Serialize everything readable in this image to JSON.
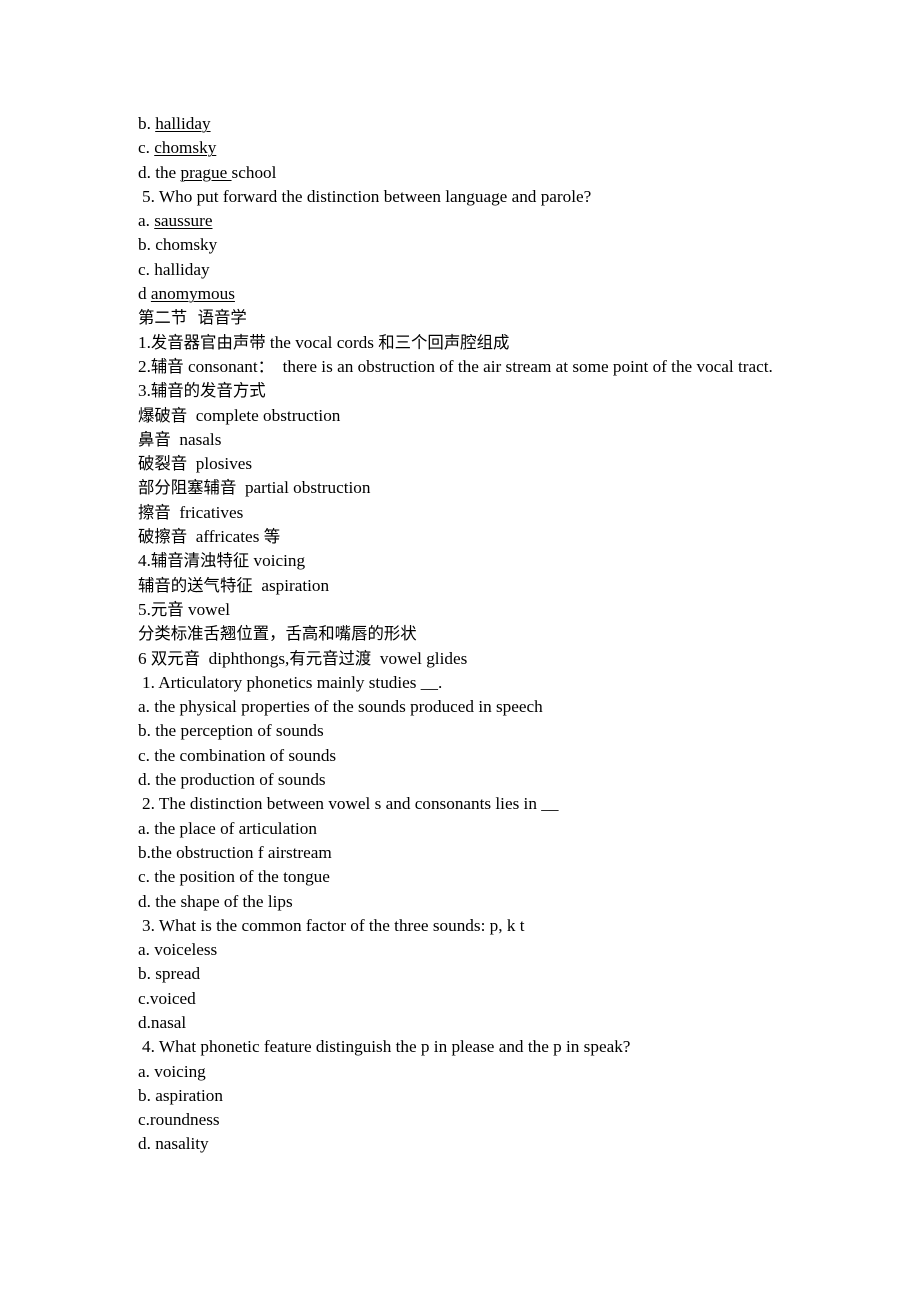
{
  "document": {
    "lines": [
      {
        "id": "opt-b-halliday",
        "indent": "option",
        "segments": [
          {
            "text": "b. ",
            "underline": false
          },
          {
            "text": "halliday",
            "underline": true
          }
        ]
      },
      {
        "id": "opt-c-chomsky",
        "indent": "option",
        "segments": [
          {
            "text": "c. ",
            "underline": false
          },
          {
            "text": "chomsky",
            "underline": true
          }
        ]
      },
      {
        "id": "opt-d-prague-school",
        "indent": "option",
        "segments": [
          {
            "text": "d. the ",
            "underline": false
          },
          {
            "text": "prague ",
            "underline": true
          },
          {
            "text": "school",
            "underline": false
          }
        ]
      },
      {
        "id": "question-5",
        "indent": "question",
        "segments": [
          {
            "text": "5. Who put forward the distinction between language and parole?",
            "underline": false
          }
        ]
      },
      {
        "id": "opt-a-saussure",
        "indent": "option",
        "segments": [
          {
            "text": "a. ",
            "underline": false
          },
          {
            "text": "saussure",
            "underline": true
          }
        ]
      },
      {
        "id": "opt-b-chomsky",
        "indent": "option",
        "segments": [
          {
            "text": "b. chomsky",
            "underline": false
          }
        ]
      },
      {
        "id": "opt-c-halliday",
        "indent": "option",
        "segments": [
          {
            "text": "c. halliday",
            "underline": false
          }
        ]
      },
      {
        "id": "opt-d-anomymous",
        "indent": "option",
        "segments": [
          {
            "text": "d ",
            "underline": false
          },
          {
            "text": "anomymous",
            "underline": true
          }
        ]
      },
      {
        "id": "section-heading",
        "indent": "option",
        "segments": [
          {
            "text": "第二节  语音学",
            "underline": false,
            "cjk": true
          }
        ]
      },
      {
        "id": "note-1-vocal-organs",
        "indent": "option",
        "segments": [
          {
            "text": "1.",
            "underline": false
          },
          {
            "text": "发音器官由声带",
            "underline": false,
            "cjk": true
          },
          {
            "text": " the vocal cords ",
            "underline": false
          },
          {
            "text": "和三个回声腔组成",
            "underline": false,
            "cjk": true
          }
        ]
      },
      {
        "id": "note-2-consonant",
        "indent": "option",
        "segments": [
          {
            "text": "2.",
            "underline": false
          },
          {
            "text": "辅音",
            "underline": false,
            "cjk": true
          },
          {
            "text": " consonant",
            "underline": false
          },
          {
            "text": "：",
            "underline": false,
            "cjk": true
          },
          {
            "text": "  there is an obstruction of the air stream at some point of the vocal tract.",
            "underline": false
          }
        ]
      },
      {
        "id": "note-3-manner",
        "indent": "option",
        "segments": [
          {
            "text": "3.",
            "underline": false
          },
          {
            "text": "辅音的发音方式",
            "underline": false,
            "cjk": true
          }
        ]
      },
      {
        "id": "term-complete-obstruction",
        "indent": "option",
        "segments": [
          {
            "text": "爆破音",
            "underline": false,
            "cjk": true
          },
          {
            "text": "  complete obstruction",
            "underline": false
          }
        ]
      },
      {
        "id": "term-nasals",
        "indent": "option",
        "segments": [
          {
            "text": "鼻音",
            "underline": false,
            "cjk": true
          },
          {
            "text": "  nasals",
            "underline": false
          }
        ]
      },
      {
        "id": "term-plosives",
        "indent": "option",
        "segments": [
          {
            "text": "破裂音",
            "underline": false,
            "cjk": true
          },
          {
            "text": "  plosives",
            "underline": false
          }
        ]
      },
      {
        "id": "term-partial-obstruction",
        "indent": "option",
        "segments": [
          {
            "text": "部分阻塞辅音",
            "underline": false,
            "cjk": true
          },
          {
            "text": "  partial obstruction",
            "underline": false
          }
        ]
      },
      {
        "id": "term-fricatives",
        "indent": "option",
        "segments": [
          {
            "text": "擦音",
            "underline": false,
            "cjk": true
          },
          {
            "text": "  fricatives",
            "underline": false
          }
        ]
      },
      {
        "id": "term-affricates",
        "indent": "option",
        "segments": [
          {
            "text": "破擦音",
            "underline": false,
            "cjk": true
          },
          {
            "text": "  affricates ",
            "underline": false
          },
          {
            "text": "等",
            "underline": false,
            "cjk": true
          }
        ]
      },
      {
        "id": "note-4-voicing",
        "indent": "option",
        "segments": [
          {
            "text": "4.",
            "underline": false
          },
          {
            "text": "辅音清浊特征",
            "underline": false,
            "cjk": true
          },
          {
            "text": " voicing",
            "underline": false
          }
        ]
      },
      {
        "id": "term-aspiration",
        "indent": "option",
        "segments": [
          {
            "text": "辅音的送气特征",
            "underline": false,
            "cjk": true
          },
          {
            "text": "  aspiration",
            "underline": false
          }
        ]
      },
      {
        "id": "note-5-vowel",
        "indent": "option",
        "segments": [
          {
            "text": "5.",
            "underline": false
          },
          {
            "text": "元音",
            "underline": false,
            "cjk": true
          },
          {
            "text": " vowel",
            "underline": false
          }
        ]
      },
      {
        "id": "note-vowel-criteria",
        "indent": "option",
        "segments": [
          {
            "text": "分类标准舌翘位置，舌高和嘴唇的形状",
            "underline": false,
            "cjk": true
          }
        ]
      },
      {
        "id": "note-6-diphthongs",
        "indent": "option",
        "segments": [
          {
            "text": "6 ",
            "underline": false
          },
          {
            "text": "双元音",
            "underline": false,
            "cjk": true
          },
          {
            "text": "  diphthongs,",
            "underline": false
          },
          {
            "text": "有元音过渡",
            "underline": false,
            "cjk": true
          },
          {
            "text": "  vowel glides",
            "underline": false
          }
        ]
      },
      {
        "id": "question-1",
        "indent": "question",
        "segments": [
          {
            "text": "1. Articulatory phonetics mainly studies __.",
            "underline": false
          }
        ]
      },
      {
        "id": "q1-opt-a",
        "indent": "option",
        "segments": [
          {
            "text": "a. the physical properties of the sounds produced in speech",
            "underline": false
          }
        ]
      },
      {
        "id": "q1-opt-b",
        "indent": "option",
        "segments": [
          {
            "text": "b. the perception of sounds",
            "underline": false
          }
        ]
      },
      {
        "id": "q1-opt-c",
        "indent": "option",
        "segments": [
          {
            "text": "c. the combination of sounds",
            "underline": false
          }
        ]
      },
      {
        "id": "q1-opt-d",
        "indent": "option",
        "segments": [
          {
            "text": "d. the production of sounds",
            "underline": false
          }
        ]
      },
      {
        "id": "question-2",
        "indent": "question",
        "segments": [
          {
            "text": "2. The distinction between vowel s and consonants lies in __",
            "underline": false
          }
        ]
      },
      {
        "id": "q2-opt-a",
        "indent": "option",
        "segments": [
          {
            "text": "a. the place of articulation",
            "underline": false
          }
        ]
      },
      {
        "id": "q2-opt-b",
        "indent": "option",
        "segments": [
          {
            "text": "b.the obstruction f airstream",
            "underline": false
          }
        ]
      },
      {
        "id": "q2-opt-c",
        "indent": "option",
        "segments": [
          {
            "text": "c. the position of the tongue",
            "underline": false
          }
        ]
      },
      {
        "id": "q2-opt-d",
        "indent": "option",
        "segments": [
          {
            "text": "d. the shape of the lips",
            "underline": false
          }
        ]
      },
      {
        "id": "question-3",
        "indent": "question",
        "segments": [
          {
            "text": "3. What is the common factor of the three sounds: p, k t",
            "underline": false
          }
        ]
      },
      {
        "id": "q3-opt-a",
        "indent": "option",
        "segments": [
          {
            "text": "a. voiceless",
            "underline": false
          }
        ]
      },
      {
        "id": "q3-opt-b",
        "indent": "option",
        "segments": [
          {
            "text": "b. spread",
            "underline": false
          }
        ]
      },
      {
        "id": "q3-opt-c",
        "indent": "option",
        "segments": [
          {
            "text": "c.voiced",
            "underline": false
          }
        ]
      },
      {
        "id": "q3-opt-d",
        "indent": "option",
        "segments": [
          {
            "text": "d.nasal",
            "underline": false
          }
        ]
      },
      {
        "id": "question-4",
        "indent": "question",
        "segments": [
          {
            "text": "4. What phonetic feature distinguish the p in please and the p in speak?",
            "underline": false
          }
        ]
      },
      {
        "id": "q4-opt-a",
        "indent": "option",
        "segments": [
          {
            "text": "a. voicing",
            "underline": false
          }
        ]
      },
      {
        "id": "q4-opt-b",
        "indent": "option",
        "segments": [
          {
            "text": "b. aspiration",
            "underline": false
          }
        ]
      },
      {
        "id": "q4-opt-c",
        "indent": "option",
        "segments": [
          {
            "text": "c.roundness",
            "underline": false
          }
        ]
      },
      {
        "id": "q4-opt-d",
        "indent": "option",
        "segments": [
          {
            "text": "d. nasality",
            "underline": false
          }
        ]
      }
    ]
  }
}
